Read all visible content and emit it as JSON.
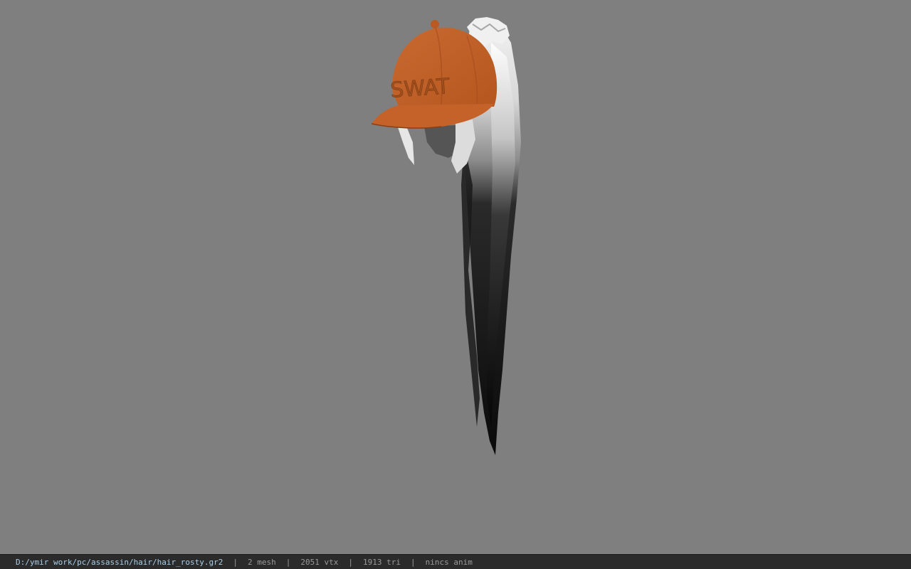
{
  "viewport": {
    "background": "#7f7f7f",
    "cap_text": "SWAT",
    "cap_color": "#c0622a",
    "hair_light_color": "#e8e8e8",
    "hair_dark_color": "#0f0f0f"
  },
  "status": {
    "path": "D:/ymir work/pc/assassin/hair/hair_rosty.gr2",
    "separator": "|",
    "mesh": "2 mesh",
    "vtx": "2051 vtx",
    "tri": "1913 tri",
    "anim": "nincs anim",
    "path_color": "#a9cde6",
    "bar_color": "#2b2b2b"
  }
}
